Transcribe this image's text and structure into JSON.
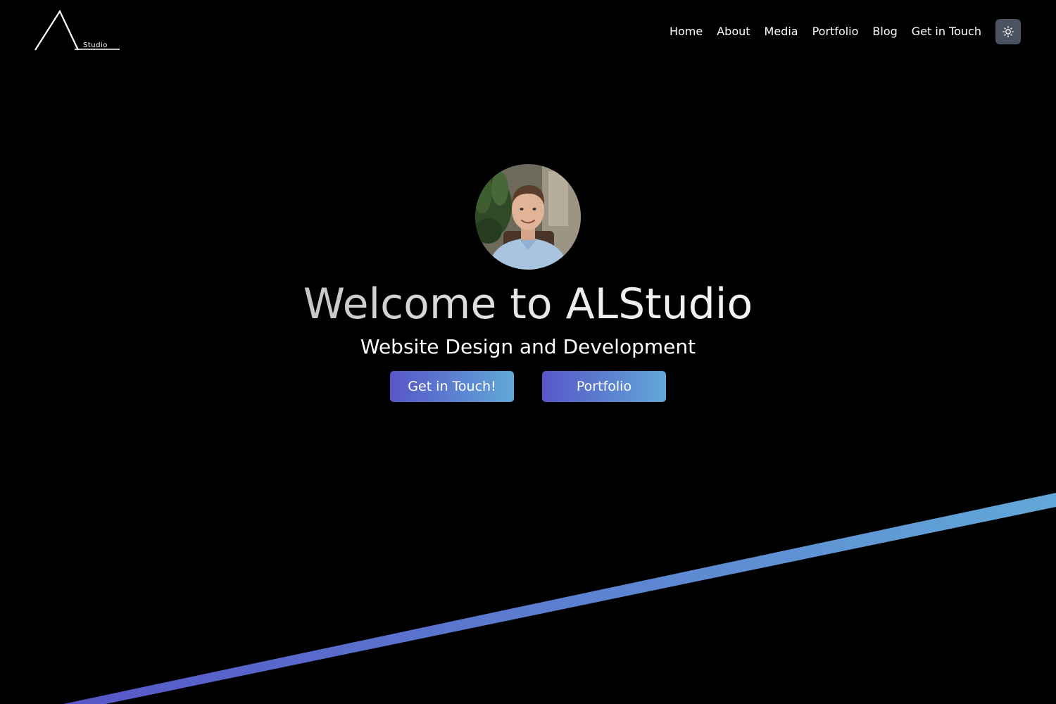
{
  "header": {
    "logo": {
      "main_letter": "A",
      "sub_text": "Studio"
    },
    "nav": [
      {
        "label": "Home"
      },
      {
        "label": "About"
      },
      {
        "label": "Media"
      },
      {
        "label": "Portfolio"
      },
      {
        "label": "Blog"
      },
      {
        "label": "Get in Touch"
      }
    ],
    "theme_toggle_icon": "sun-icon"
  },
  "hero": {
    "avatar_icon": "profile-photo",
    "title": "Welcome to ALStudio",
    "subtitle": "Website Design and Development",
    "buttons": {
      "primary_label": "Get in Touch!",
      "secondary_label": "Portfolio"
    }
  },
  "colors": {
    "background": "#000000",
    "text": "#ffffff",
    "gradient_start": "#5656c8",
    "gradient_end": "#62a8d8",
    "toggle_bg": "#4b5262"
  }
}
